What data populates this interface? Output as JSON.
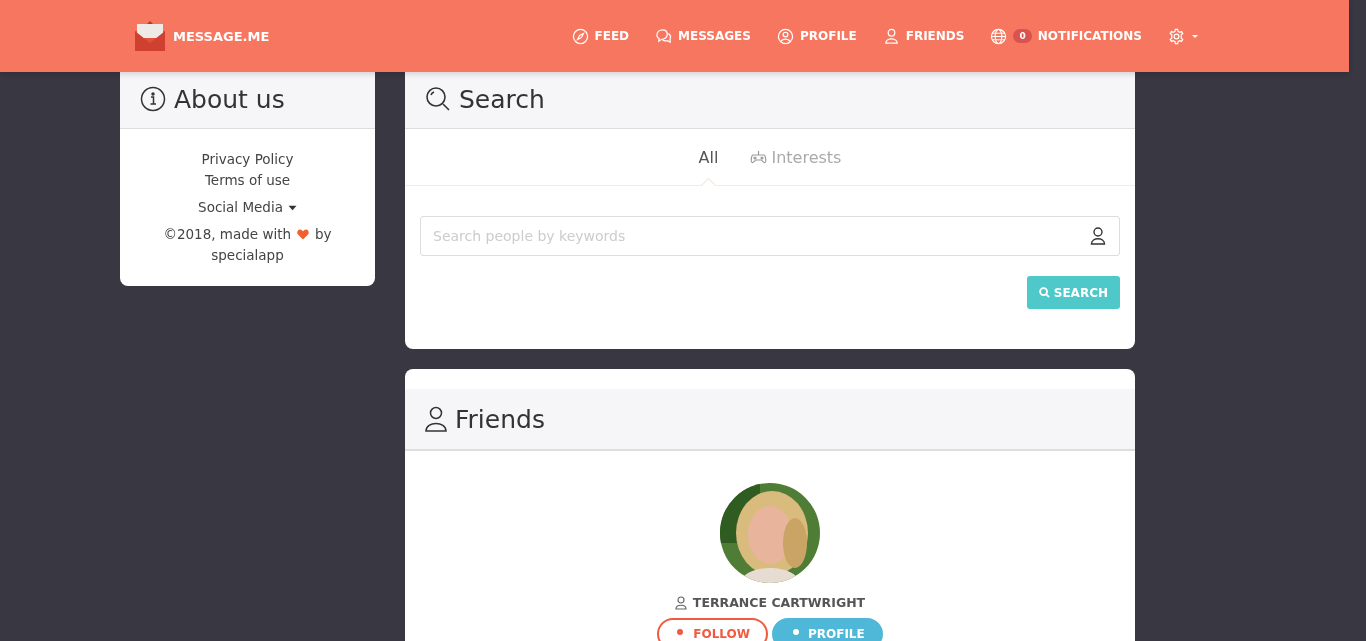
{
  "navbar": {
    "brand": "MESSAGE.ME",
    "items": [
      {
        "kind": "feed",
        "label": "FEED"
      },
      {
        "kind": "messages",
        "label": "MESSAGES"
      },
      {
        "kind": "profile",
        "label": "PROFILE"
      },
      {
        "kind": "friends",
        "label": "FRIENDS"
      },
      {
        "kind": "notifications",
        "label": "NOTIFICATIONS",
        "badge": "0"
      }
    ]
  },
  "about": {
    "title": "About us",
    "links": [
      "Privacy Policy",
      "Terms of use"
    ],
    "social": "Social Media",
    "credit_before": "©2018, made with",
    "credit_after": "by",
    "credit_name": "specialapp"
  },
  "search": {
    "title": "Search",
    "tabs": [
      {
        "label": "All",
        "selected": true
      },
      {
        "label": "Interests",
        "selected": false
      }
    ],
    "placeholder": "Search people by keywords",
    "button": "SEARCH"
  },
  "friends": {
    "title": "Friends",
    "people": [
      {
        "name": "TERRANCE CARTWRIGHT",
        "follow": "FOLLOW",
        "profile": "PROFILE"
      }
    ]
  }
}
